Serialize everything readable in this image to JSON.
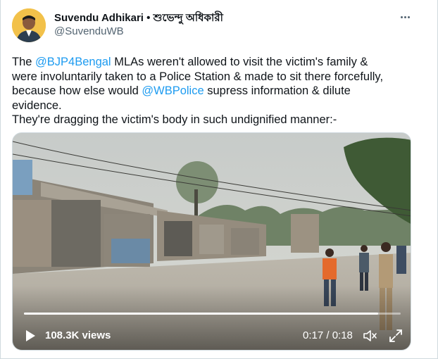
{
  "author": {
    "name": "Suvendu Adhikari • শুভেন্দু অধিকারী",
    "handle": "@SuvenduWB",
    "avatar_icon": "profile-photo"
  },
  "menu_icon": "more-horizontal-icon",
  "tweet": {
    "l1_pre": "The ",
    "mention_party": "@BJP4Bengal",
    "l1_post": " MLAs weren't allowed to visit the victim's family &",
    "l2": "were involuntarily taken to a Police Station & made to sit there forcefully,",
    "l3_pre": "because how else would ",
    "mention_police": "@WBPolice",
    "l3_post": " supress information & dilute",
    "l4": "evidence.",
    "l5": "They're dragging the victim's body in such undignified manner:-"
  },
  "video": {
    "views": "108.3K views",
    "time": "0:17 / 0:18",
    "progress": 0.94,
    "play_icon": "play-icon",
    "volume_icon": "volume-muted-icon",
    "fullscreen_icon": "fullscreen-icon"
  },
  "colors": {
    "link": "#1d9bf0",
    "secondary": "#536471",
    "text": "#0f1419"
  }
}
